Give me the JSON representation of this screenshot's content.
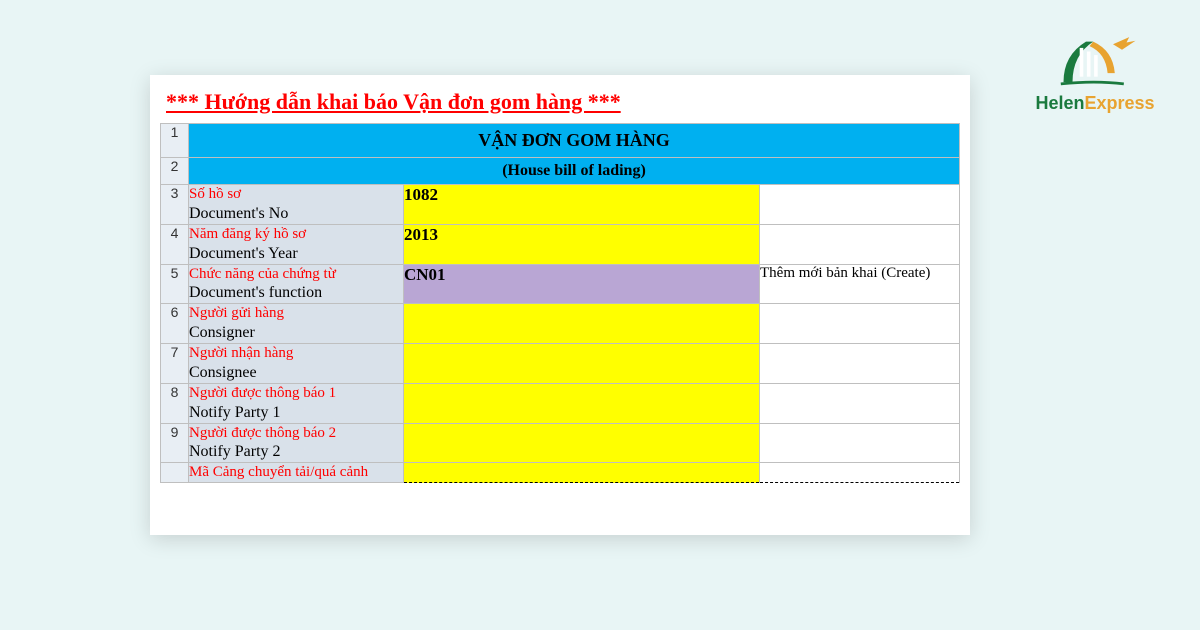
{
  "title": "*** Hướng dẫn khai báo Vận đơn gom hàng ***",
  "header": {
    "row1": "VẬN ĐƠN GOM HÀNG",
    "row2": "(House bill of lading)"
  },
  "rows": [
    {
      "num": "3",
      "vi": "Số hồ sơ",
      "en": "Document's No",
      "value": "1082",
      "valueClass": "yellow",
      "desc": ""
    },
    {
      "num": "4",
      "vi": "Năm đăng ký hồ sơ",
      "en": "Document's Year",
      "value": "2013",
      "valueClass": "yellow",
      "desc": ""
    },
    {
      "num": "5",
      "vi": "Chức năng của chứng từ",
      "en": "Document's function",
      "value": "CN01",
      "valueClass": "purple",
      "desc": "Thêm mới bản khai (Create)"
    },
    {
      "num": "6",
      "vi": "Người gửi hàng",
      "en": "Consigner",
      "value": "",
      "valueClass": "yellow",
      "desc": ""
    },
    {
      "num": "7",
      "vi": "Người nhận hàng",
      "en": "Consignee",
      "value": "",
      "valueClass": "yellow",
      "desc": ""
    },
    {
      "num": "8",
      "vi": "Người được thông báo 1",
      "en": "Notify Party 1",
      "value": "",
      "valueClass": "yellow",
      "desc": ""
    },
    {
      "num": "9",
      "vi": "Người được thông báo 2",
      "en": "Notify Party 2",
      "value": "",
      "valueClass": "yellow",
      "desc": ""
    }
  ],
  "lastRow": {
    "num": "",
    "vi": "Mã Cảng chuyển tải/quá cảnh"
  },
  "logo": {
    "part1": "Helen",
    "part2": "Express"
  }
}
